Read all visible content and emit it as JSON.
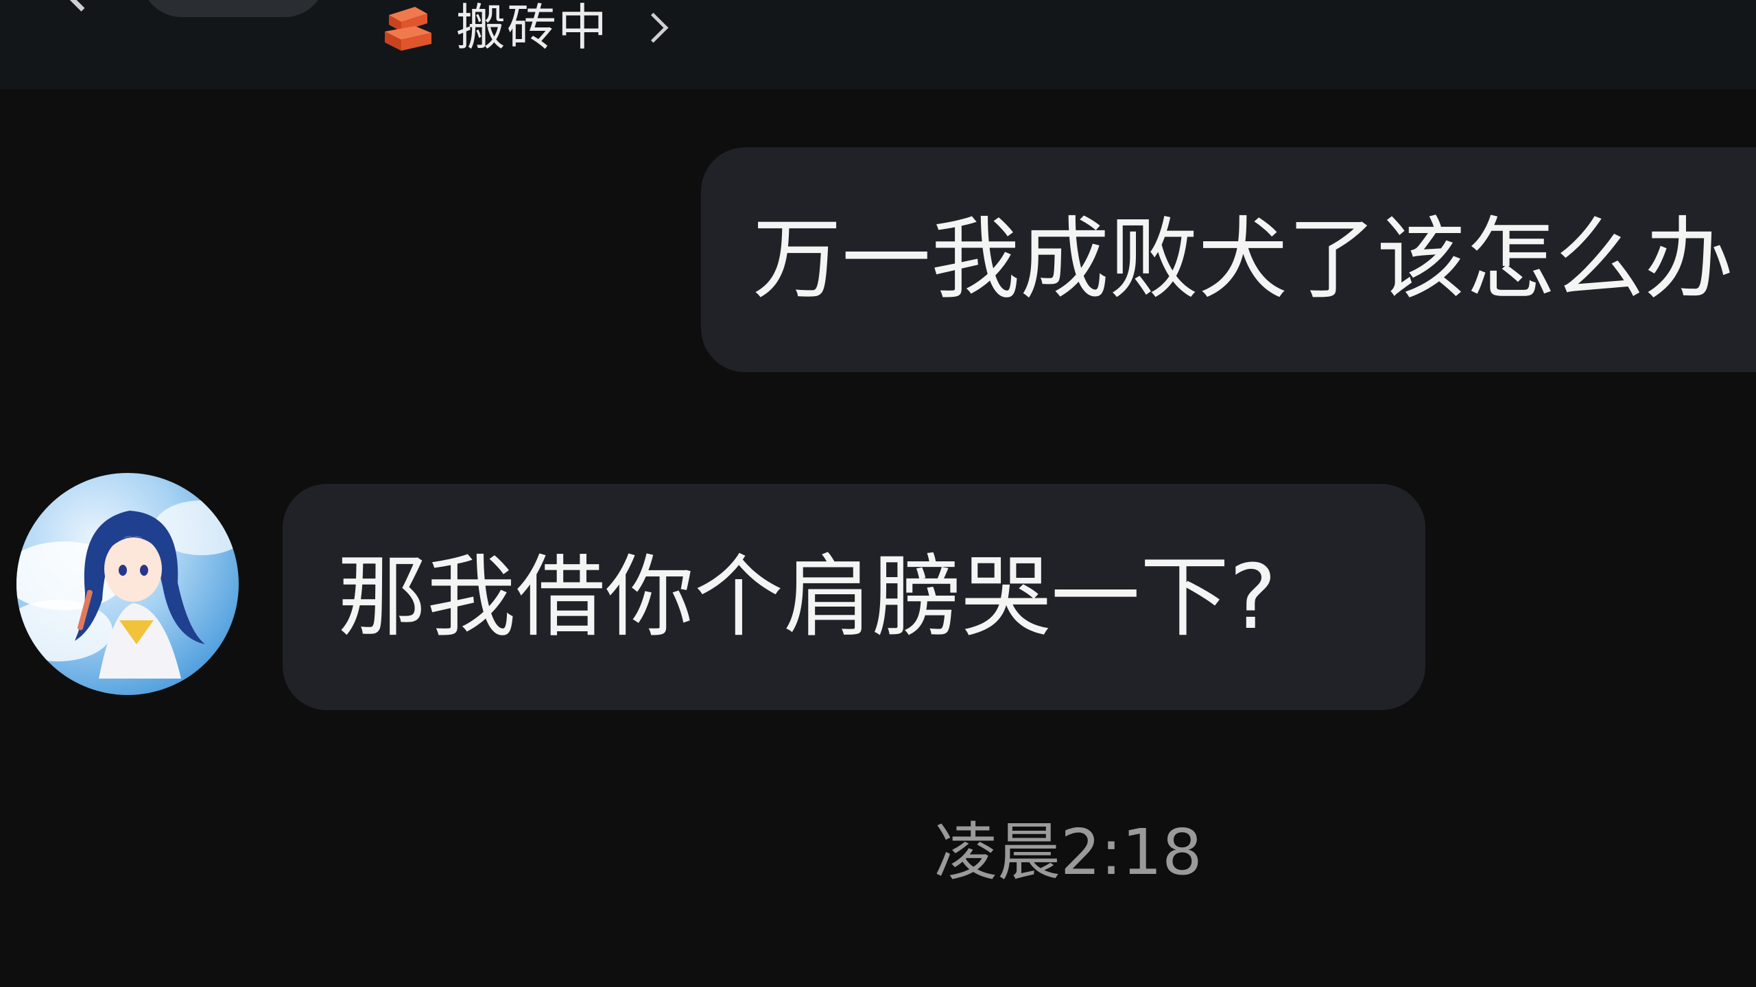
{
  "header": {
    "status_text": "搬砖中",
    "status_icon": "brick-icon",
    "back_icon": "back-arrow-icon",
    "chevron_icon": "chevron-right-icon"
  },
  "messages": [
    {
      "direction": "outgoing",
      "text": "万一我成败犬了该怎么办"
    },
    {
      "direction": "incoming",
      "text": "那我借你个肩膀哭一下?"
    }
  ],
  "timestamp": "凌晨2:18",
  "colors": {
    "background": "#0e0e0e",
    "header": "#131619",
    "bubble": "#202227",
    "brick": "#e0552c",
    "timestamp": "#9a9a9a"
  }
}
